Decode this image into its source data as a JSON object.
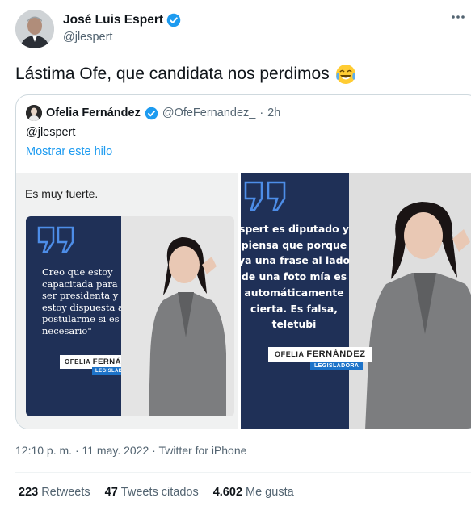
{
  "author": {
    "name": "José Luis Espert",
    "handle": "@jlespert"
  },
  "tweet": {
    "text": "Lástima Ofe, que candidata nos perdimos",
    "emoji": "😂"
  },
  "quote": {
    "name": "Ofelia Fernández",
    "handle": "@OfeFernandez_",
    "separator": "·",
    "time": "2h",
    "reply_to": "@jlespert",
    "show_thread": "Mostrar este hilo",
    "image_left": {
      "caption": "Es muy fuerte.",
      "quote_text": "Creo que estoy capacitada para ser presidenta y estoy dispuesta a postularme si es necesario\"",
      "label_first": "OFELIA",
      "label_last": "FERNÁNDEZ",
      "label_role": "LEGISLADORA"
    },
    "image_right": {
      "quote_lines": [
        "spert es diputado y",
        "piensa que porque",
        "ya una frase al lado",
        "de una foto mía es",
        "automáticamente",
        "cierta. Es falsa,",
        "teletubi"
      ],
      "label_first": "OFELIA",
      "label_last": "FERNÁNDEZ",
      "label_role": "LEGISLADORA"
    }
  },
  "meta": {
    "time": "12:10 p. m.",
    "separator": "·",
    "date": "11 may. 2022",
    "source": "Twitter for iPhone"
  },
  "stats": [
    {
      "count": "223",
      "label": "Retweets"
    },
    {
      "count": "47",
      "label": "Tweets citados"
    },
    {
      "count": "4.602",
      "label": "Me gusta"
    }
  ],
  "colors": {
    "verified": "#1d9bf0",
    "link": "#1d9bf0",
    "secondary_text": "#536471",
    "panel_navy": "#1f3057"
  },
  "icons": {
    "verified": "verified-badge-icon",
    "more": "more-dots-icon",
    "quote_marks": "quote-marks-icon"
  }
}
